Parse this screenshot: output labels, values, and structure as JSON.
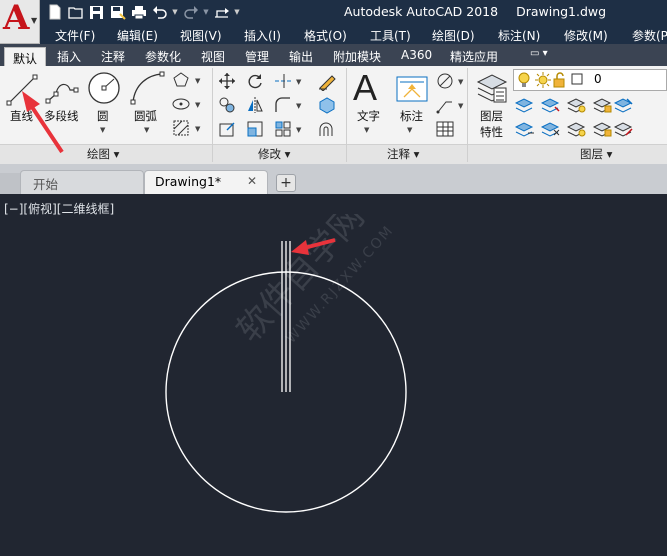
{
  "app": {
    "title": "Autodesk AutoCAD 2018",
    "document": "Drawing1.dwg",
    "logo_letter": "A",
    "brand_red": "#c6141b"
  },
  "quick_access": [
    "new-icon",
    "open-icon",
    "save-icon",
    "save-as-icon",
    "print-icon",
    "undo-icon",
    "redo-icon",
    "share-icon"
  ],
  "menu": [
    "文件(F)",
    "编辑(E)",
    "视图(V)",
    "插入(I)",
    "格式(O)",
    "工具(T)",
    "绘图(D)",
    "标注(N)",
    "修改(M)",
    "参数(P)"
  ],
  "ribbon_tabs": [
    "默认",
    "插入",
    "注释",
    "参数化",
    "视图",
    "管理",
    "输出",
    "附加模块",
    "A360",
    "精选应用"
  ],
  "ribbon_tab_extra": "▭ ▾",
  "panels": {
    "draw": {
      "title": "绘图 ▾",
      "line": "直线",
      "polyline": "多段线",
      "circle": "圆",
      "arc": "圆弧"
    },
    "modify": {
      "title": "修改 ▾"
    },
    "annotation": {
      "title": "注释 ▾",
      "text": "文字",
      "dimension": "标注"
    },
    "layers": {
      "title": "图层 ▾",
      "layer_props_1": "图层",
      "layer_props_2": "特性",
      "current_layer": "0"
    }
  },
  "doc_tabs": {
    "start": "开始",
    "drawing": "Drawing1*",
    "close": "✕",
    "new": "+"
  },
  "viewport": {
    "label": "[−][俯视][二维线框]"
  },
  "watermark": {
    "line1": "软件自学网",
    "line2": "WWW.RJZXW.COM"
  },
  "colors": {
    "title_bar": "#1e2f45",
    "canvas": "#212631",
    "annotation_arrow": "#e8333b",
    "drawing_lines": "#ffffff"
  }
}
